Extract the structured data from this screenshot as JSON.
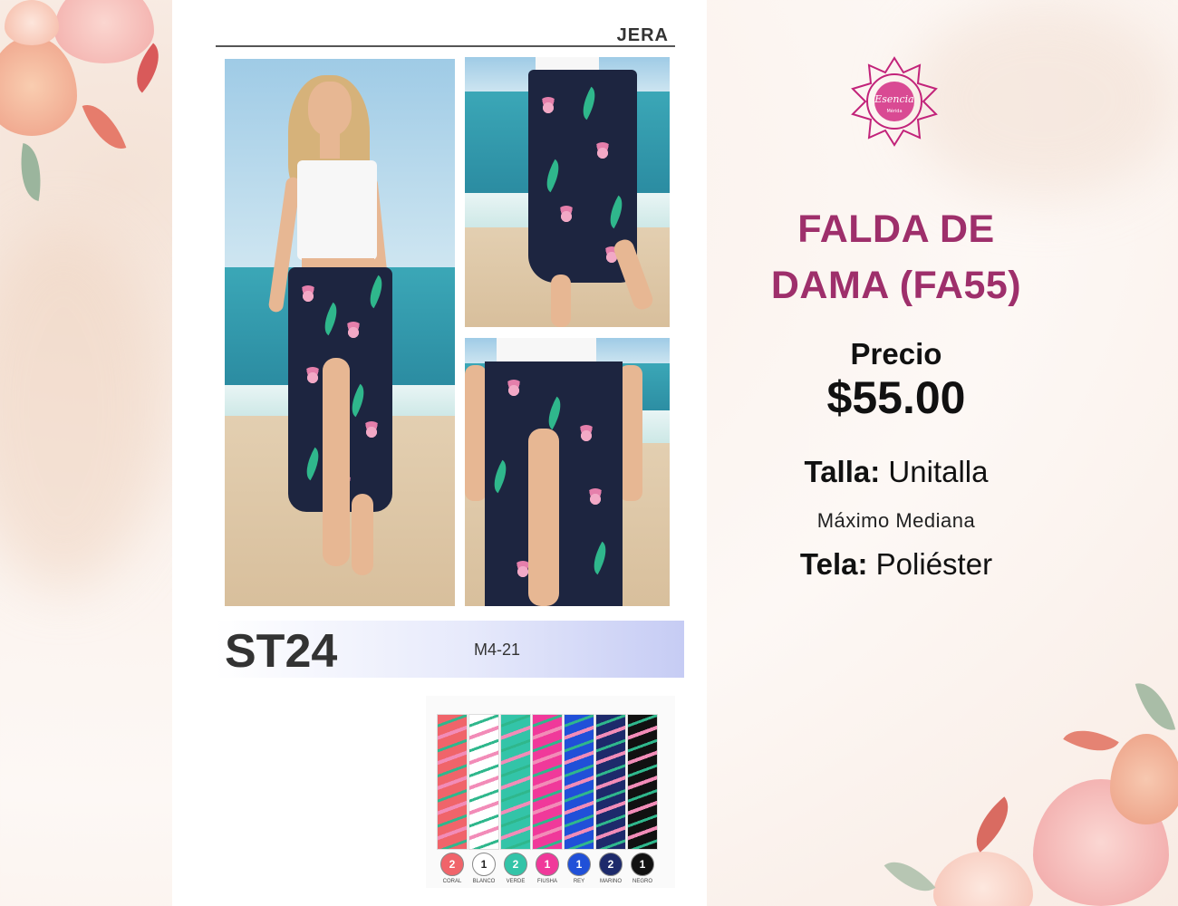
{
  "catalog": {
    "brand": "JERA",
    "style_code": "ST24",
    "ref_code": "M4-21",
    "color_swatches": [
      {
        "count": "2",
        "name": "CORAL",
        "color": "#f0646a"
      },
      {
        "count": "1",
        "name": "BLANCO",
        "color": "#ffffff"
      },
      {
        "count": "2",
        "name": "VERDE",
        "color": "#33c4a8"
      },
      {
        "count": "1",
        "name": "FIUSHA",
        "color": "#f0399a"
      },
      {
        "count": "1",
        "name": "REY",
        "color": "#2050d8"
      },
      {
        "count": "2",
        "name": "MARINO",
        "color": "#1d2a6b"
      },
      {
        "count": "1",
        "name": "NEGRO",
        "color": "#111111"
      }
    ]
  },
  "product": {
    "logo_text": "Esencia",
    "logo_subtext": "Mérida",
    "title_line1": "FALDA DE",
    "title_line2": "DAMA (FA55)",
    "price_label": "Precio",
    "price": "$55.00",
    "size_label": "Talla:",
    "size_value": "Unitalla",
    "size_note": "Máximo Mediana",
    "fabric_label": "Tela:",
    "fabric_value": "Poliéster"
  },
  "colors": {
    "accent": "#9e2f6b",
    "skirt_base": "#1d2540"
  }
}
